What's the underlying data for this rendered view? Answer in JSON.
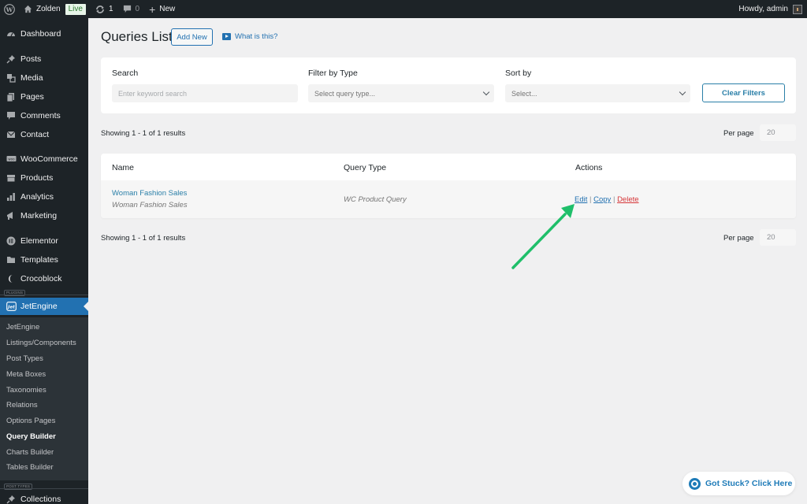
{
  "adminbar": {
    "site_name": "Zolden",
    "live_badge": "Live",
    "updates_count": "1",
    "comments_count": "0",
    "new_label": "New",
    "greeting": "Howdy, admin"
  },
  "sidebar": {
    "items": [
      {
        "label": "Dashboard",
        "icon": "dashboard-icon"
      },
      {
        "label": "Posts",
        "icon": "pin-icon"
      },
      {
        "label": "Media",
        "icon": "media-icon"
      },
      {
        "label": "Pages",
        "icon": "pages-icon"
      },
      {
        "label": "Comments",
        "icon": "comment-icon"
      },
      {
        "label": "Contact",
        "icon": "mail-icon"
      },
      {
        "label": "WooCommerce",
        "icon": "woo-icon"
      },
      {
        "label": "Products",
        "icon": "archive-icon"
      },
      {
        "label": "Analytics",
        "icon": "chart-bar-icon"
      },
      {
        "label": "Marketing",
        "icon": "megaphone-icon"
      },
      {
        "label": "Elementor",
        "icon": "elementor-icon"
      },
      {
        "label": "Templates",
        "icon": "folder-icon"
      },
      {
        "label": "Crocoblock",
        "icon": "crocoblock-icon"
      },
      {
        "label": "JetEngine",
        "icon": "jetengine-icon"
      },
      {
        "label": "Collections",
        "icon": "pin-icon"
      }
    ],
    "plugins_separator": "PLUGINS",
    "post_types_separator": "POST TYPES",
    "submenu": [
      "JetEngine",
      "Listings/Components",
      "Post Types",
      "Meta Boxes",
      "Taxonomies",
      "Relations",
      "Options Pages",
      "Query Builder",
      "Charts Builder",
      "Tables Builder"
    ],
    "current_submenu": "Query Builder"
  },
  "header": {
    "title": "Queries List",
    "add_new": "Add New",
    "what_is_this": "What is this?"
  },
  "filters": {
    "search_label": "Search",
    "search_placeholder": "Enter keyword search",
    "type_label": "Filter by Type",
    "type_placeholder": "Select query type...",
    "sort_label": "Sort by",
    "sort_placeholder": "Select...",
    "clear_label": "Clear Filters"
  },
  "pagination": {
    "results_text": "Showing 1 - 1 of 1 results",
    "per_page_label": "Per page",
    "per_page_value": "20"
  },
  "table": {
    "columns": [
      "Name",
      "Query Type",
      "Actions"
    ],
    "rows": [
      {
        "name": "Woman Fashion Sales",
        "subtitle": "Woman Fashion Sales",
        "query_type": "WC Product Query",
        "actions": {
          "edit": "Edit",
          "copy": "Copy",
          "delete": "Delete",
          "separator": "|"
        }
      }
    ]
  },
  "help": {
    "label": "Got Stuck? Click Here"
  },
  "colors": {
    "accent": "#2271b1",
    "admin_dark": "#1d2327",
    "delete": "#d63638",
    "annotation_arrow": "#1fbf6a"
  }
}
